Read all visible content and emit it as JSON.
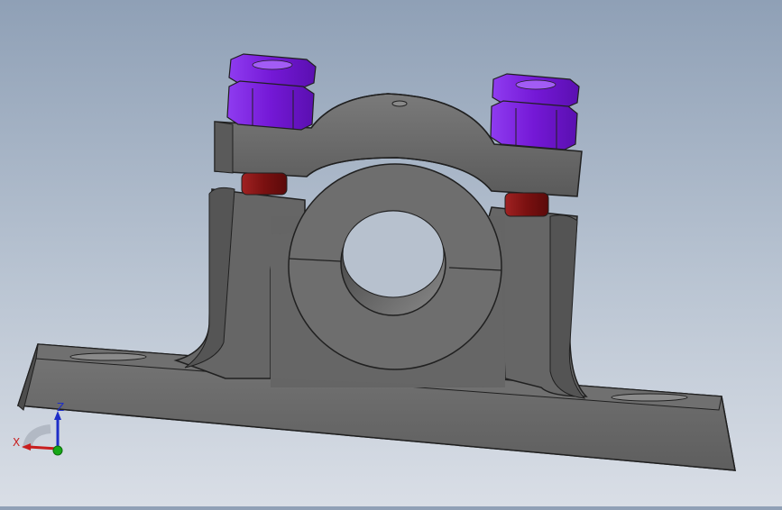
{
  "viewport": {
    "background_top": "#8fa0b6",
    "background_bottom": "#d9dee6"
  },
  "model": {
    "part_name": "pillow-block-shaft-support",
    "body_color": "#6b6b6b",
    "edge_color": "#202020",
    "nut_color": "#7a1fd9",
    "spacer_color": "#8b1a1a"
  },
  "triad": {
    "x_label": "X",
    "z_label": "Z",
    "x_color": "#c81e1e",
    "y_color": "#16a816",
    "z_color": "#1e2ec8"
  }
}
